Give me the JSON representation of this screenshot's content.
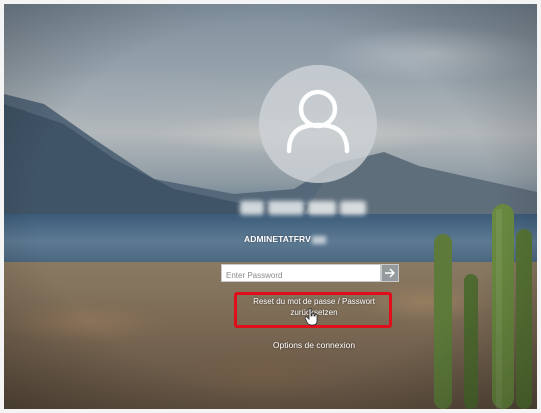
{
  "login": {
    "account_name": "ADMINETATFRV",
    "password_placeholder": "Enter Password",
    "reset_password_link": "Reset du mot de passe / Passwort zurücksetzen",
    "sign_in_options": "Options de connexion"
  },
  "colors": {
    "highlight_outline": "#e00d1a",
    "text": "#ffffff"
  },
  "icons": {
    "avatar": "user-icon",
    "submit": "arrow-right-icon",
    "cursor": "hand-pointer-icon"
  }
}
